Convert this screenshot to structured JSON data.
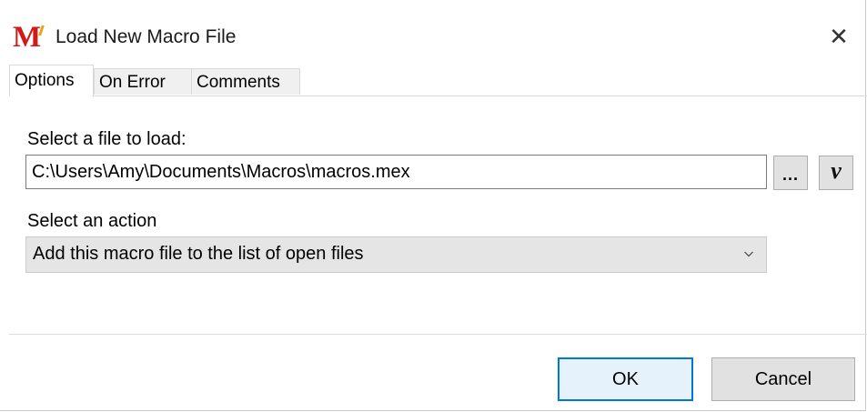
{
  "window": {
    "title": "Load New Macro File",
    "close_glyph": "✕",
    "app_icon": "macro-m-logo-icon",
    "app_icon_letter": "M"
  },
  "tabs": [
    {
      "label": "Options",
      "active": true
    },
    {
      "label": "On Error",
      "active": false
    },
    {
      "label": "Comments",
      "active": false
    }
  ],
  "options": {
    "file_label": "Select a file to load:",
    "file_path": "C:\\Users\\Amy\\Documents\\Macros\\macros.mex",
    "browse_label": "...",
    "variable_label": "v",
    "action_label": "Select an action",
    "action_value": "Add this macro file to the list of open files"
  },
  "buttons": {
    "ok": "OK",
    "cancel": "Cancel"
  },
  "colors": {
    "accent": "#0078d7",
    "logo_red": "#d11a1a",
    "logo_gold": "#e8a21a"
  }
}
